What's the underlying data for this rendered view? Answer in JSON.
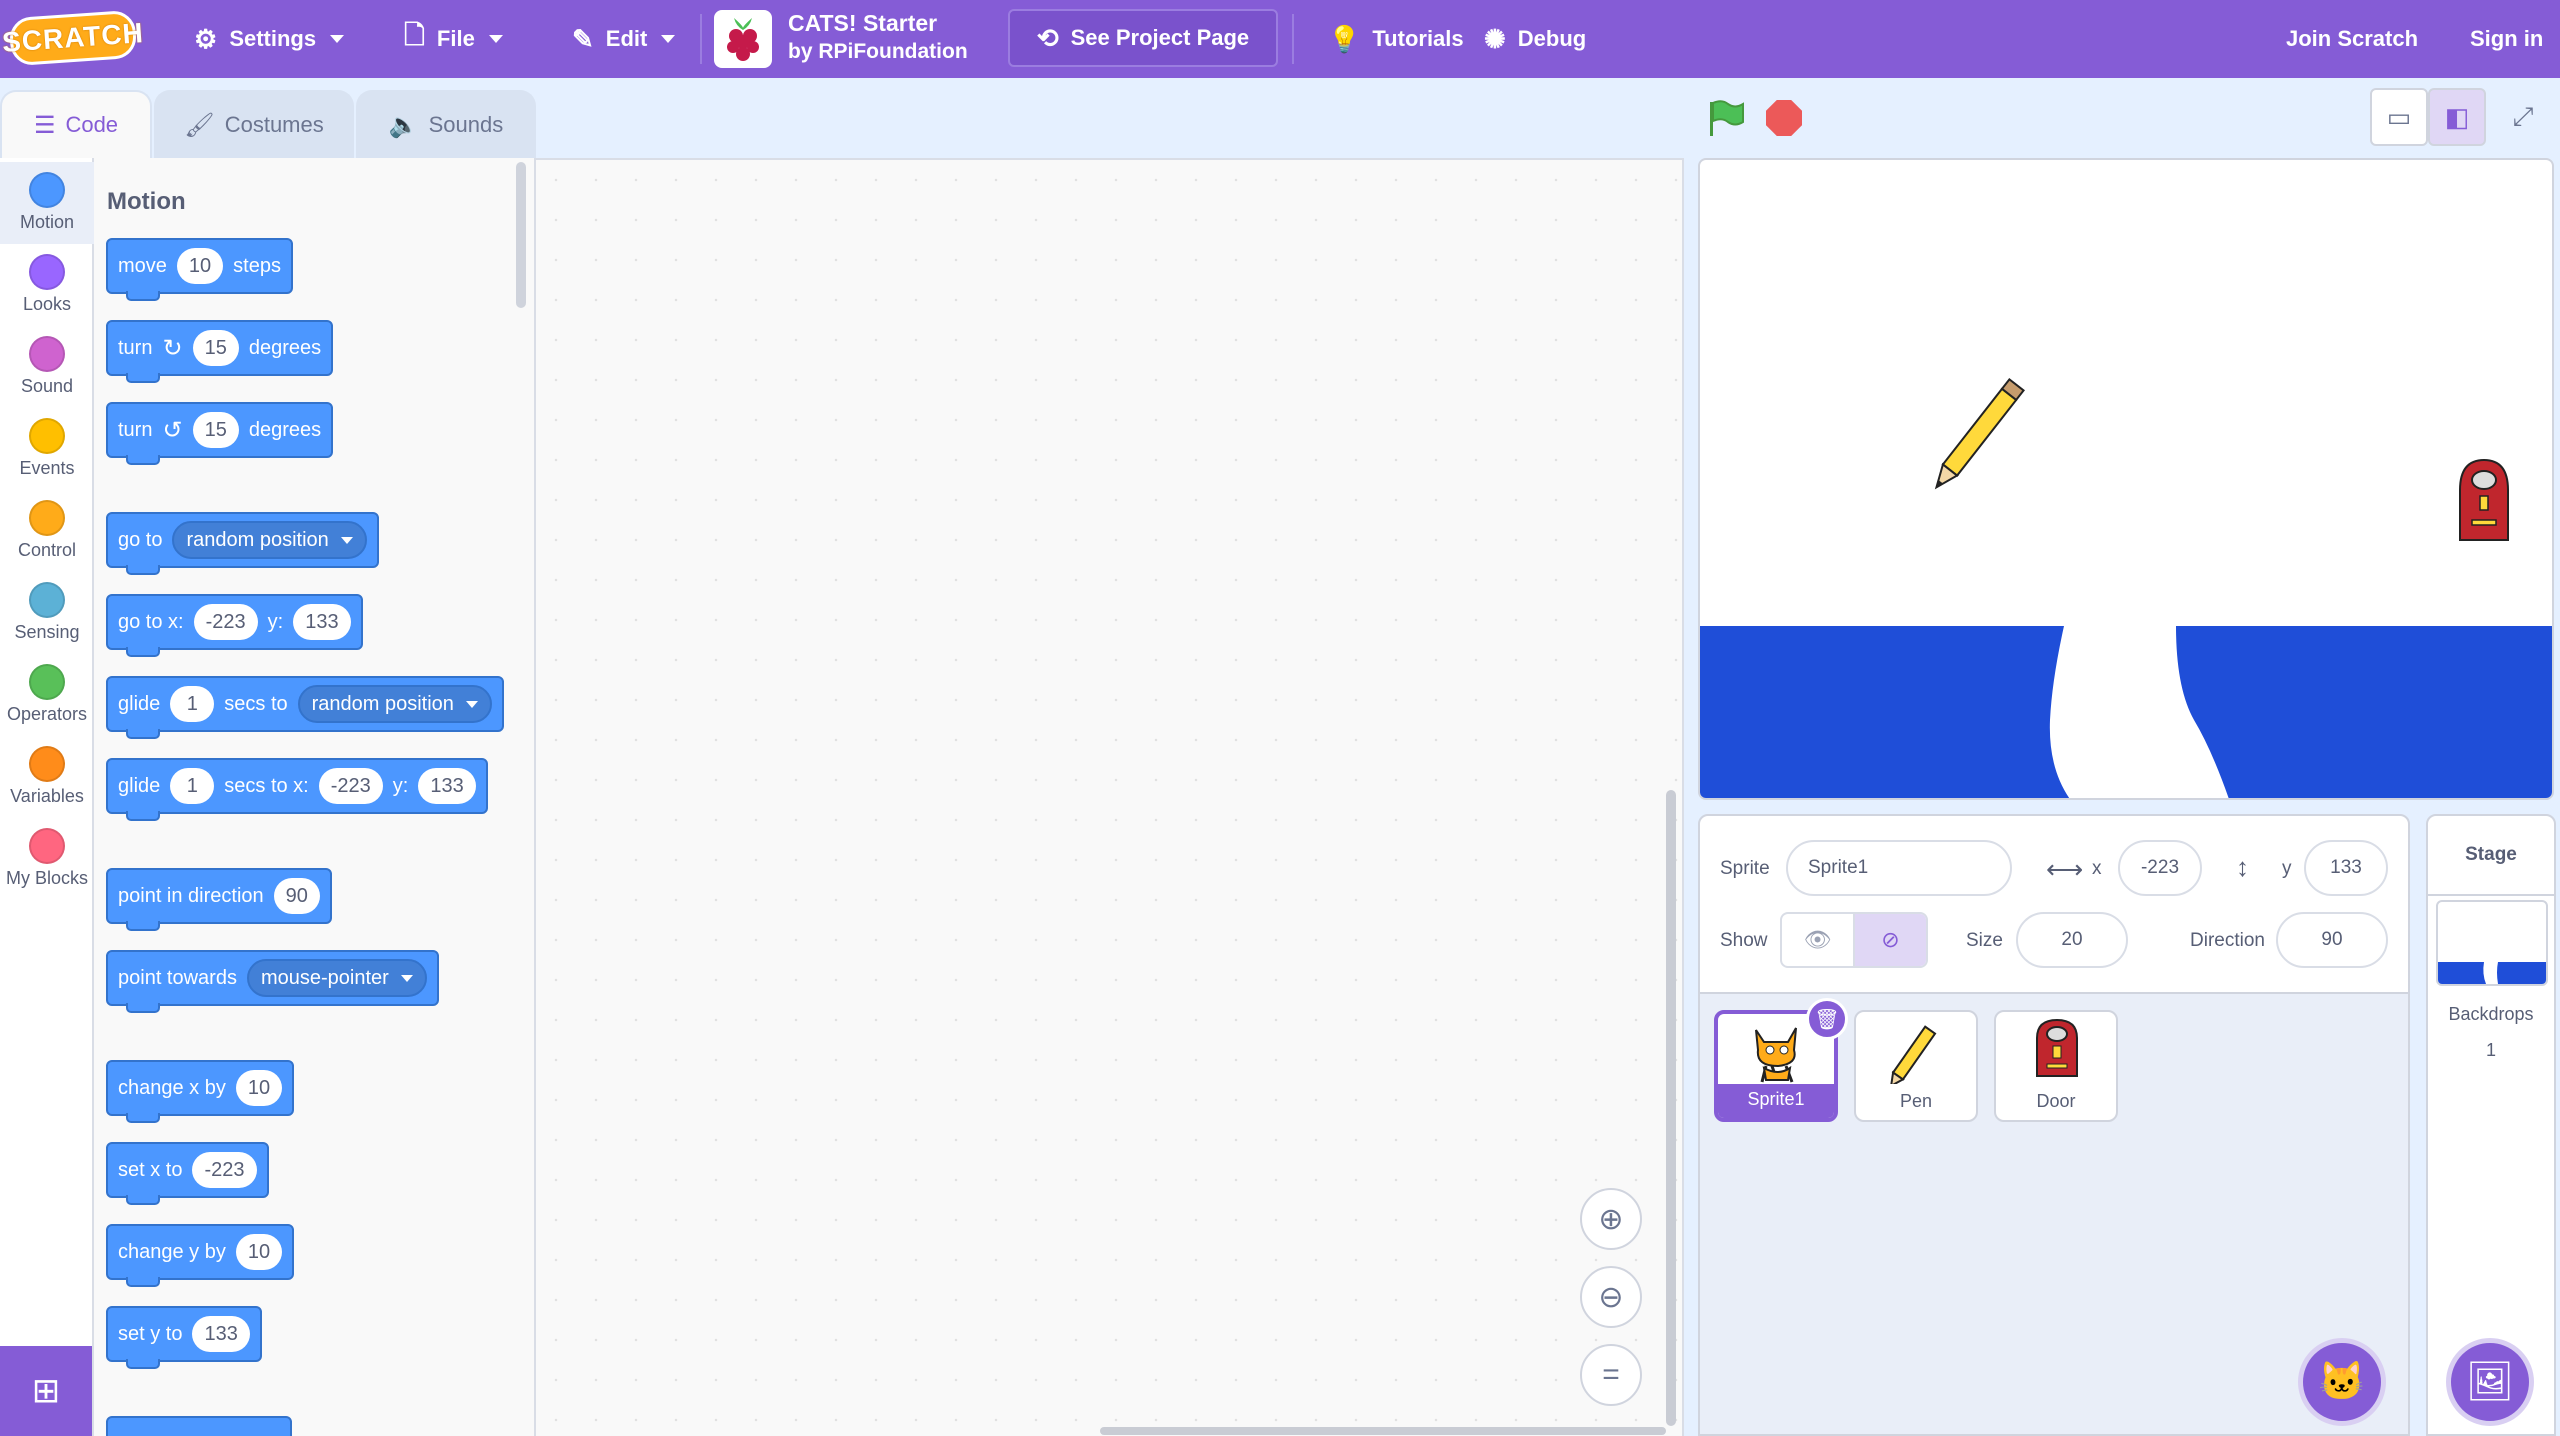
{
  "menubar": {
    "logo": "SCRATCH",
    "settings": "Settings",
    "file": "File",
    "edit": "Edit",
    "project_title": "CATS! Starter",
    "project_author": "by RPiFoundation",
    "see_project": "See Project Page",
    "tutorials": "Tutorials",
    "debug": "Debug",
    "join": "Join Scratch",
    "signin": "Sign in",
    "accent": "#855cd6"
  },
  "tabs": {
    "code": "Code",
    "costumes": "Costumes",
    "sounds": "Sounds"
  },
  "categories": [
    {
      "label": "Motion",
      "color": "#4c97ff"
    },
    {
      "label": "Looks",
      "color": "#9966ff"
    },
    {
      "label": "Sound",
      "color": "#cf63cf"
    },
    {
      "label": "Events",
      "color": "#ffbf00"
    },
    {
      "label": "Control",
      "color": "#ffab19"
    },
    {
      "label": "Sensing",
      "color": "#5cb1d6"
    },
    {
      "label": "Operators",
      "color": "#59c059"
    },
    {
      "label": "Variables",
      "color": "#ff8c1a"
    },
    {
      "label": "My Blocks",
      "color": "#ff6680"
    }
  ],
  "flyout": {
    "title": "Motion",
    "blocks": {
      "move": {
        "t1": "move",
        "v": "10",
        "t2": "steps"
      },
      "turn_right": {
        "t1": "turn",
        "v": "15",
        "t2": "degrees"
      },
      "turn_left": {
        "t1": "turn",
        "v": "15",
        "t2": "degrees"
      },
      "goto": {
        "t1": "go to",
        "dd": "random position"
      },
      "goto_xy": {
        "t1": "go to x:",
        "x": "-223",
        "t2": "y:",
        "y": "133"
      },
      "glide": {
        "t1": "glide",
        "v": "1",
        "t2": "secs to",
        "dd": "random position"
      },
      "glide_xy": {
        "t1": "glide",
        "v": "1",
        "t2": "secs to x:",
        "x": "-223",
        "t3": "y:",
        "y": "133"
      },
      "point_dir": {
        "t1": "point in direction",
        "v": "90"
      },
      "point_towards": {
        "t1": "point towards",
        "dd": "mouse-pointer"
      },
      "change_x": {
        "t1": "change x by",
        "v": "10"
      },
      "set_x": {
        "t1": "set x to",
        "v": "-223"
      },
      "change_y": {
        "t1": "change y by",
        "v": "10"
      },
      "set_y": {
        "t1": "set y to",
        "v": "133"
      }
    }
  },
  "sprite_info": {
    "sprite_label": "Sprite",
    "sprite_name": "Sprite1",
    "x_label": "x",
    "x": "-223",
    "y_label": "y",
    "y": "133",
    "show_label": "Show",
    "size_label": "Size",
    "size": "20",
    "direction_label": "Direction",
    "direction": "90"
  },
  "sprites": [
    {
      "name": "Sprite1",
      "selected": true
    },
    {
      "name": "Pen",
      "selected": false
    },
    {
      "name": "Door",
      "selected": false
    }
  ],
  "stage_panel": {
    "title": "Stage",
    "backdrops_label": "Backdrops",
    "backdrops_count": "1"
  },
  "colors": {
    "motion": "#4c97ff",
    "stage_water": "#1f4ed8",
    "stop": "#ec5959",
    "flag": "#4cbf56"
  }
}
